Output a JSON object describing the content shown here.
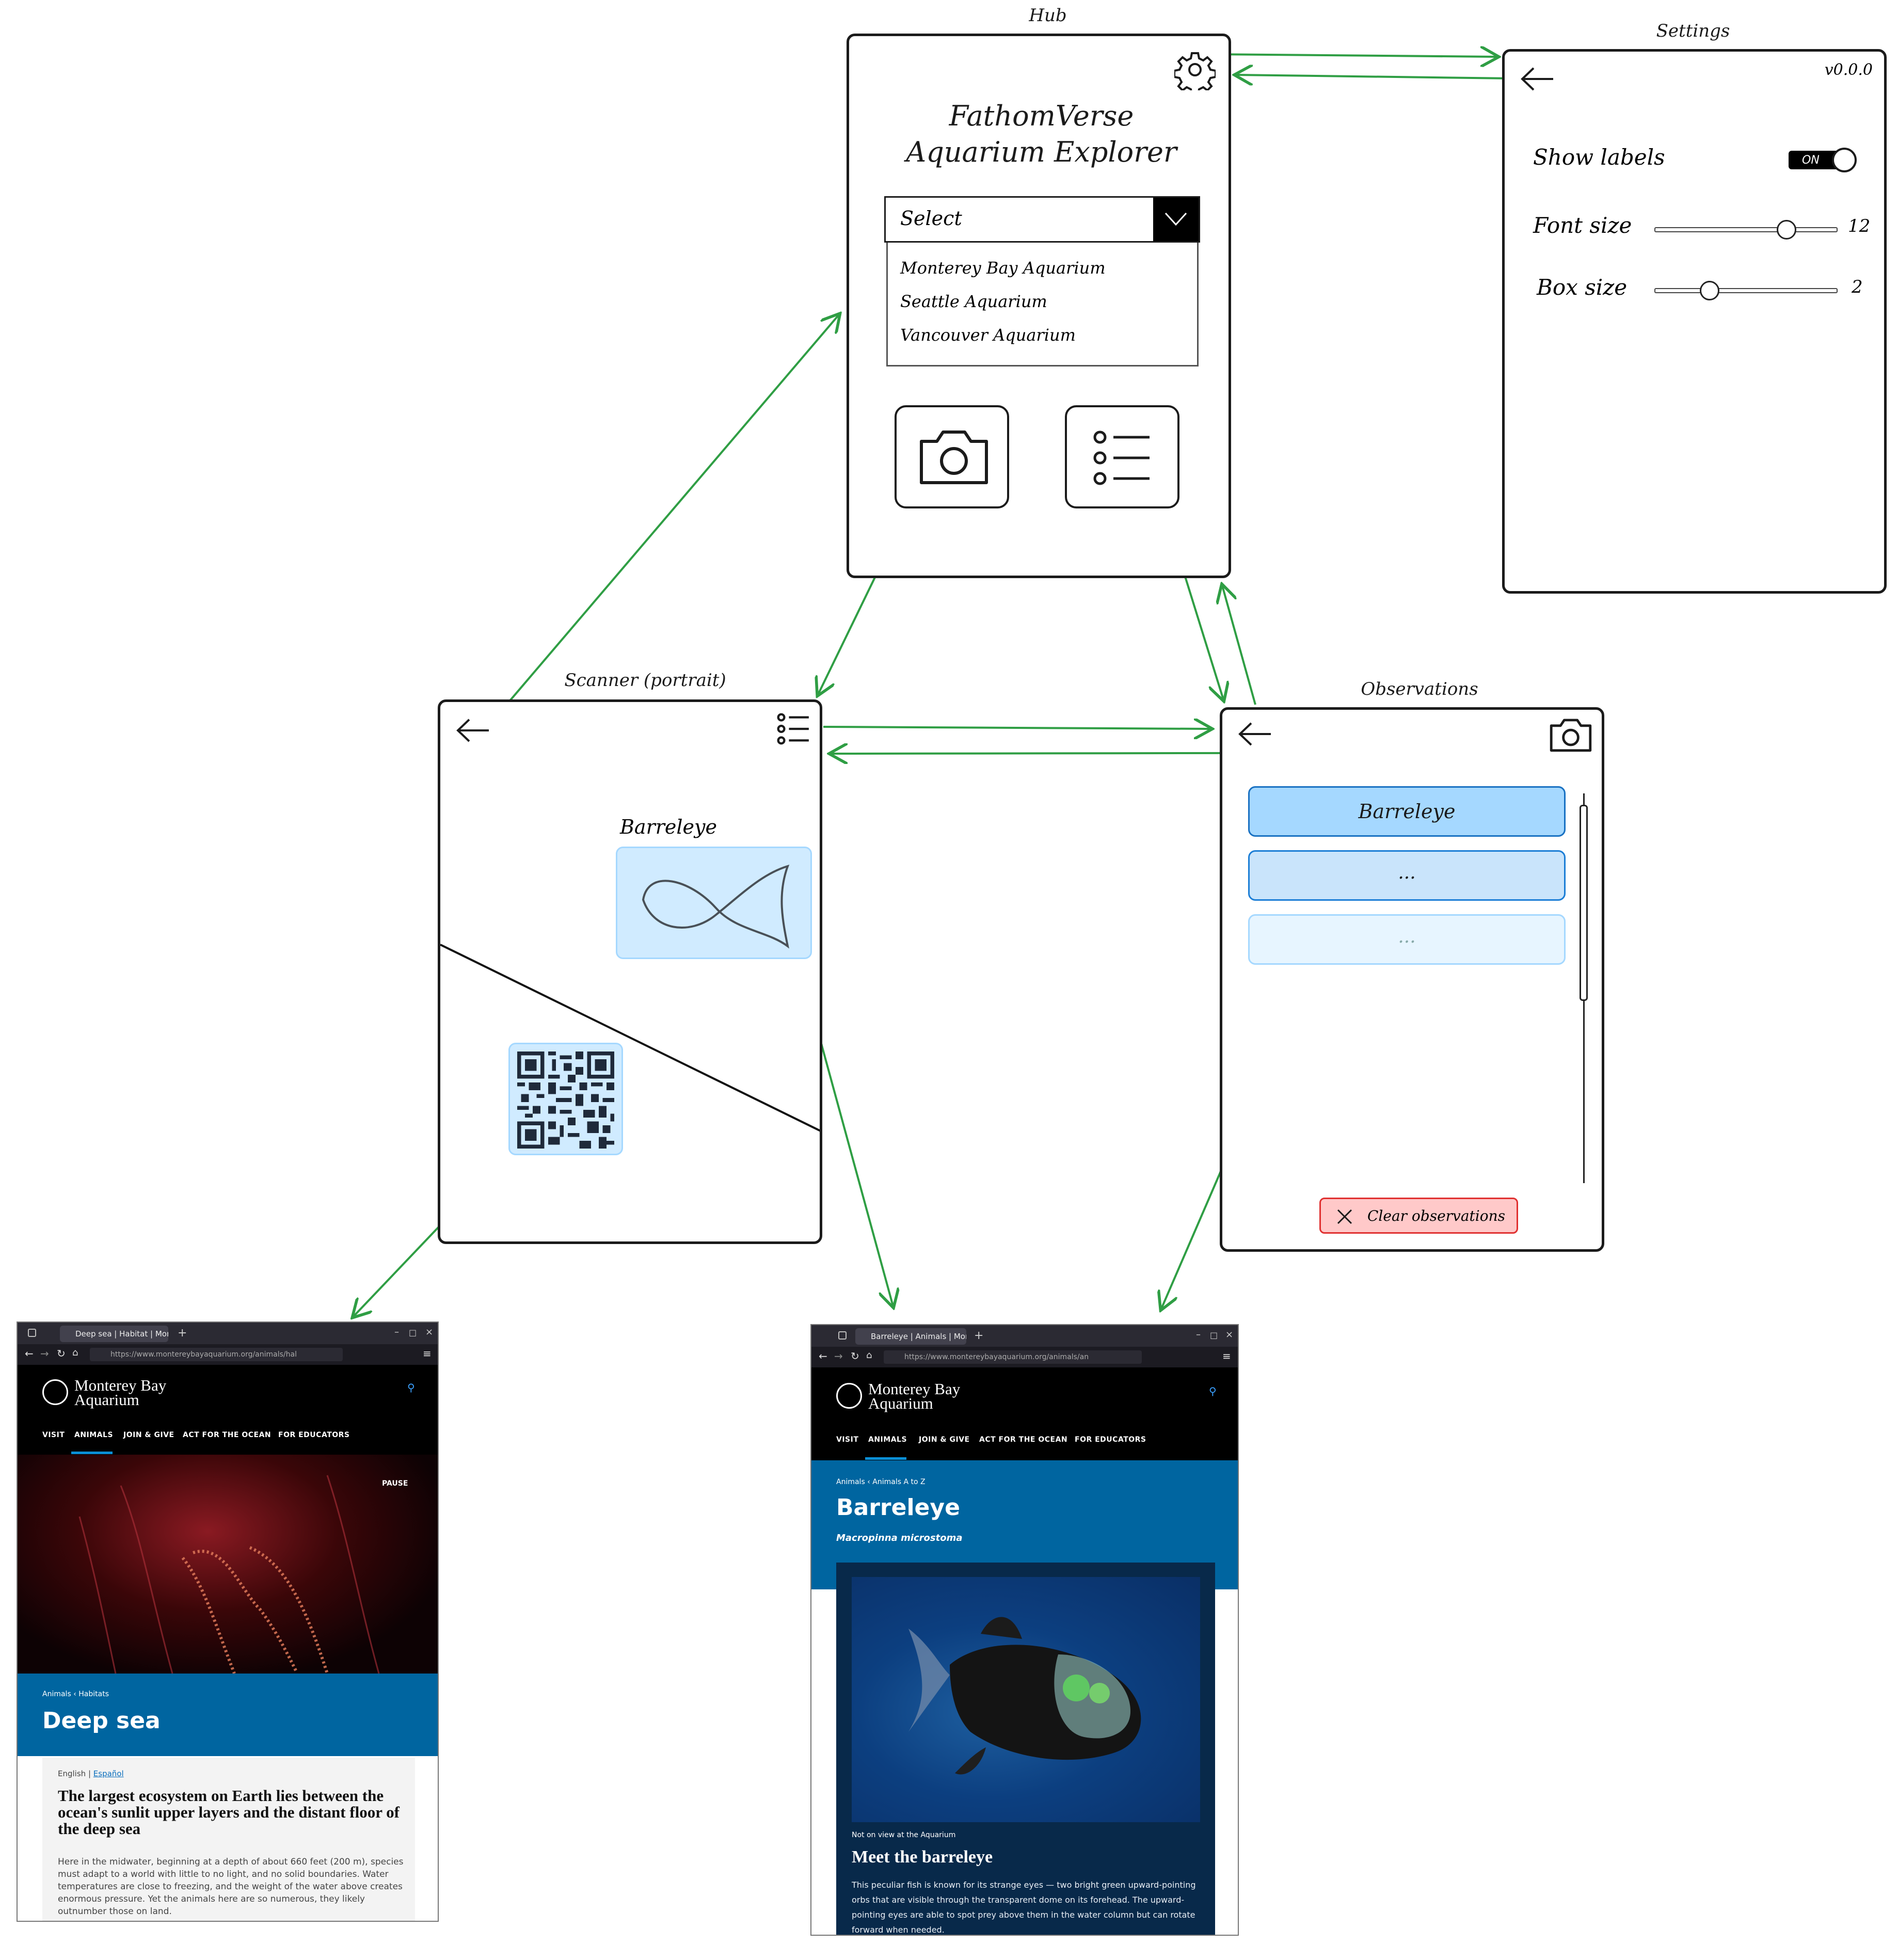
{
  "hub": {
    "title": "Hub",
    "app_title_line1": "FathomVerse",
    "app_title_line2": "Aquarium Explorer",
    "select_label": "Select",
    "options": [
      "Monterey Bay Aquarium",
      "Seattle Aquarium",
      "Vancouver Aquarium"
    ],
    "icons": [
      "gear-icon",
      "chevron-down-icon",
      "camera-icon",
      "list-icon"
    ]
  },
  "settings": {
    "title": "Settings",
    "version": "v0.0.0",
    "show_labels_label": "Show labels",
    "toggle_text": "ON",
    "toggle_on": true,
    "font_size_label": "Font size",
    "font_size_value": "12",
    "font_size_fraction": 0.72,
    "box_size_label": "Box size",
    "box_size_value": "2",
    "box_size_fraction": 0.3
  },
  "scanner": {
    "title": "Scanner (portrait)",
    "detection_label": "Barreleye",
    "icons": [
      "back-arrow-icon",
      "list-icon",
      "fish-sketch-icon",
      "qr-code-icon"
    ]
  },
  "observations": {
    "title": "Observations",
    "items": [
      "Barreleye",
      "...",
      "..."
    ],
    "clear_button": "Clear observations",
    "icons": [
      "back-arrow-icon",
      "camera-icon",
      "close-icon"
    ]
  },
  "browser_deep_sea": {
    "tab_title": "Deep sea | Habitat | Mon",
    "url": "https://www.montereybayaquarium.org/animals/hal",
    "logo_line1": "Monterey Bay",
    "logo_line2": "Aquarium",
    "nav": [
      "VISIT",
      "ANIMALS",
      "JOIN & GIVE",
      "ACT FOR THE OCEAN",
      "FOR EDUCATORS"
    ],
    "pause": "PAUSE",
    "breadcrumb1": "Animals",
    "breadcrumb2": "Habitats",
    "heading": "Deep sea",
    "lang_en": "English",
    "lang_es": "Español",
    "card_title": "The largest ecosystem on Earth lies between the ocean's sunlit upper layers and the distant floor of the deep sea",
    "card_body": "Here in the midwater, beginning at a depth of about 660 feet (200 m), species must adapt to a world with little to no light, and no solid boundaries. Water temperatures are close to freezing, and the weight of the water above creates enormous pressure. Yet the animals here are so numerous, they likely outnumber those on land."
  },
  "browser_barreleye": {
    "tab_title": "Barreleye | Animals | Mon",
    "url": "https://www.montereybayaquarium.org/animals/an",
    "logo_line1": "Monterey Bay",
    "logo_line2": "Aquarium",
    "nav": [
      "VISIT",
      "ANIMALS",
      "JOIN & GIVE",
      "ACT FOR THE OCEAN",
      "FOR EDUCATORS"
    ],
    "breadcrumb1": "Animals",
    "breadcrumb2": "Animals A to Z",
    "heading": "Barreleye",
    "scientific_name": "Macropinna microstoma",
    "not_on_view": "Not on view at the Aquarium",
    "meet_title": "Meet the barreleye",
    "meet_body": "This peculiar fish is known for its strange eyes — two bright green upward-pointing orbs that are visible through the transparent dome on its forehead. The upward-pointing eyes are able to spot prey above them in the water column but can rotate forward when needed."
  },
  "colors": {
    "arrow": "#2f9e44",
    "selected_item": "#a5d8ff",
    "item_mid": "#c9e4fb",
    "item_light": "#e7f5ff",
    "clear_button_bg": "#ffc9c9",
    "mba_blue": "#0065a0"
  }
}
